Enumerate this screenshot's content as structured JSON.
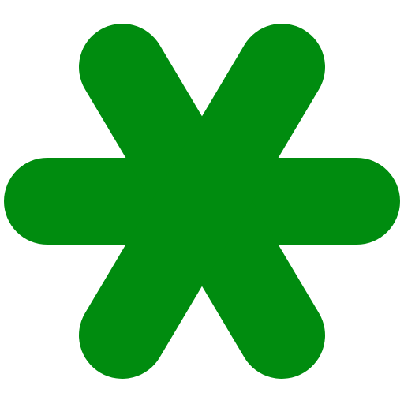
{
  "icon": {
    "name": "asterisk-icon",
    "color": "#008C0F",
    "background": "#FFFFFF"
  }
}
